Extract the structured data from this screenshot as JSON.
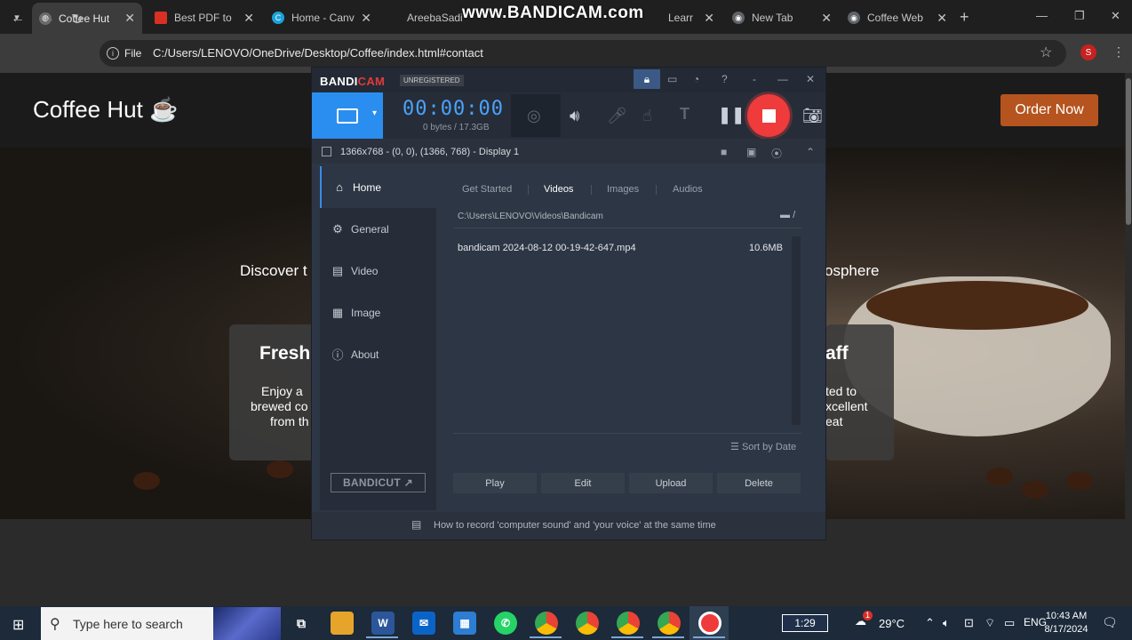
{
  "browser": {
    "tabs": [
      {
        "title": "Coffee Hut",
        "favicon": "globe-icon",
        "active": true
      },
      {
        "title": "Best PDF to",
        "favicon": "pdf-icon",
        "active": false
      },
      {
        "title": "Home - Canv",
        "favicon": "canva-icon",
        "active": false
      },
      {
        "title": "AreebaSadi",
        "favicon": "github-icon",
        "active": false
      },
      {
        "title": "Learr",
        "favicon": "learn-icon",
        "active": false
      },
      {
        "title": "New Tab",
        "favicon": "chrome-icon",
        "active": false
      },
      {
        "title": "Coffee Web",
        "favicon": "web-icon",
        "active": false
      }
    ],
    "watermark": "www.BANDICAM.com",
    "address_chip": "File",
    "url": "C:/Users/LENOVO/OneDrive/Desktop/Coffee/index.html#contact",
    "profile_initial": "S"
  },
  "site": {
    "brand": "Coffee Hut",
    "brand_icon": "coffee-cup-icon",
    "order_button": "Order Now",
    "hero_left": "Discover t",
    "hero_right": "osphere",
    "card_left": {
      "title": "Fresh",
      "lines": [
        "Enjoy a",
        "brewed co",
        "from th"
      ]
    },
    "card_right": {
      "title": "aff",
      "lines": [
        "ted to",
        "xcellent",
        "eat"
      ]
    }
  },
  "bandicam": {
    "logo_main": "BANDI",
    "logo_accent": "CAM",
    "unregistered": "UNREGISTERED",
    "timer": "00:00:00",
    "size": "0 bytes / 17.3GB",
    "display_info": "1366x768 - (0, 0), (1366, 768) - Display 1",
    "sidebar": [
      {
        "label": "Home",
        "icon": "home-icon",
        "active": true
      },
      {
        "label": "General",
        "icon": "gear-icon",
        "active": false
      },
      {
        "label": "Video",
        "icon": "video-settings-icon",
        "active": false
      },
      {
        "label": "Image",
        "icon": "image-settings-icon",
        "active": false
      },
      {
        "label": "About",
        "icon": "info-icon",
        "active": false
      }
    ],
    "bandicut": "BANDICUT",
    "tabs": [
      "Get Started",
      "Videos",
      "Images",
      "Audios"
    ],
    "active_tab": "Videos",
    "path": "C:\\Users\\LENOVO\\Videos\\Bandicam",
    "path_suffix": "/",
    "files": [
      {
        "name": "bandicam 2024-08-12 00-19-42-647.mp4",
        "size": "10.6MB"
      }
    ],
    "sort": "Sort by Date",
    "buttons": [
      "Play",
      "Edit",
      "Upload",
      "Delete"
    ],
    "footer": "How to record 'computer sound' and 'your voice' at the same time",
    "accent_color": "#2a8ef0",
    "record_color": "#ef3b3b"
  },
  "taskbar": {
    "search_placeholder": "Type here to search",
    "battery": "1:29",
    "weather": "29°C",
    "time": "10:43 AM",
    "date": "8/17/2024",
    "notification_badge": "1"
  }
}
